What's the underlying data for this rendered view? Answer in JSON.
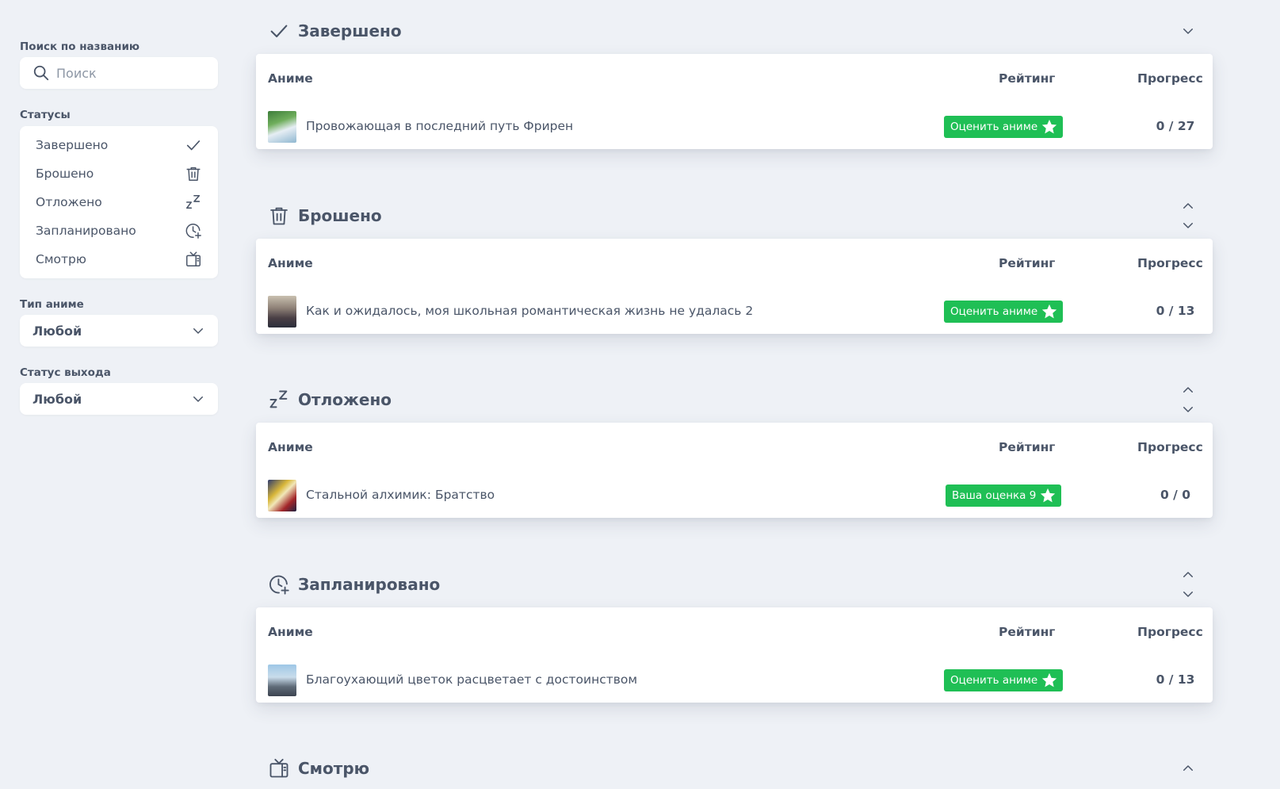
{
  "sidebar": {
    "search_label": "Поиск по названию",
    "search_placeholder": "Поиск",
    "statuses_label": "Статусы",
    "statuses": [
      {
        "label": "Завершено",
        "icon": "check-icon"
      },
      {
        "label": "Брошено",
        "icon": "trash-icon"
      },
      {
        "label": "Отложено",
        "icon": "zz-icon"
      },
      {
        "label": "Запланировано",
        "icon": "clock-plus-icon"
      },
      {
        "label": "Смотрю",
        "icon": "tv-icon"
      }
    ],
    "type_label": "Тип аниме",
    "type_value": "Любой",
    "release_label": "Статус выхода",
    "release_value": "Любой"
  },
  "table_headers": {
    "anime": "Аниме",
    "rating": "Рейтинг",
    "progress": "Прогресс"
  },
  "sections": [
    {
      "title": "Завершено",
      "icon": "check-icon",
      "arrows": [
        "down"
      ],
      "row": {
        "title": "Провожающая в последний путь Фрирен",
        "rating": "Оценить аниме",
        "progress": "0 / 27"
      }
    },
    {
      "title": "Брошено",
      "icon": "trash-icon",
      "arrows": [
        "up",
        "down"
      ],
      "row": {
        "title": "Как и ожидалось, моя школьная романтическая жизнь не удалась 2",
        "rating": "Оценить аниме",
        "progress": "0 / 13"
      }
    },
    {
      "title": "Отложено",
      "icon": "zz-icon",
      "arrows": [
        "up",
        "down"
      ],
      "row": {
        "title": "Стальной алхимик: Братство",
        "rating": "Ваша оценка 9",
        "progress": "0 / 0"
      }
    },
    {
      "title": "Запланировано",
      "icon": "clock-plus-icon",
      "arrows": [
        "up",
        "down"
      ],
      "row": {
        "title": "Благоухающий цветок расцветает с достоинством",
        "rating": "Оценить аниме",
        "progress": "0 / 13"
      }
    },
    {
      "title": "Смотрю",
      "icon": "tv-icon",
      "arrows": [
        "up"
      ]
    }
  ],
  "colors": {
    "accent_green": "#1fbf55",
    "background": "#eef1f6",
    "text": "#4a5568"
  }
}
